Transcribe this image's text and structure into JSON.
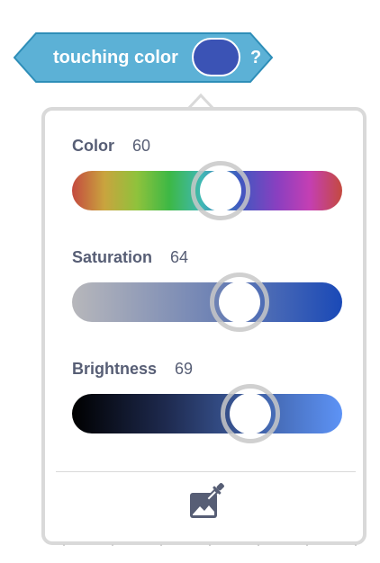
{
  "block": {
    "label": "touching color",
    "question": "?",
    "block_color": "#5cb1d6",
    "block_border": "#2e8eb8",
    "swatch_color": "#3b53b5"
  },
  "color_picker": {
    "sliders": [
      {
        "name": "Color",
        "value": "60",
        "fraction": 0.55,
        "gradient": "linear-gradient(to right, #c44a3f 0%, #c9a43e 12%, #8fc23c 24%, #3db845 36%, #3fb8b5 48%, #3f58c0 62%, #8a3fc0 76%, #c43fb3 88%, #c44a3f 100%)"
      },
      {
        "name": "Saturation",
        "value": "64",
        "fraction": 0.62,
        "gradient": "linear-gradient(to right, #b7b7bb 0%, #6b80b4 55%, #1a49b7 100%)"
      },
      {
        "name": "Brightness",
        "value": "69",
        "fraction": 0.66,
        "gradient": "linear-gradient(to right, #000000 0%, #1e2a4f 35%, #3a5796 62%, #5d93f6 100%)"
      }
    ],
    "eyedropper_icon": "eyedropper-icon"
  }
}
